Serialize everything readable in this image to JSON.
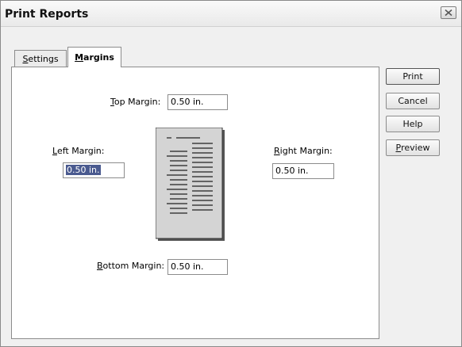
{
  "window": {
    "title": "Print Reports"
  },
  "tabs": [
    {
      "label_ul": "S",
      "label_rest": "ettings"
    },
    {
      "label_ul": "M",
      "label_rest": "argins"
    }
  ],
  "margins": {
    "top": {
      "label_ul": "T",
      "label_rest": "op Margin:",
      "value": "0.50 in."
    },
    "left": {
      "label_ul": "L",
      "label_rest": "eft Margin:",
      "value": "0.50 in."
    },
    "right": {
      "label_ul": "R",
      "label_rest": "ight Margin:",
      "value": "0.50 in."
    },
    "bottom": {
      "label_ul": "B",
      "label_rest": "ottom Margin:",
      "value": "0.50 in."
    }
  },
  "buttons": {
    "print": "Print",
    "cancel": "Cancel",
    "help": "Help",
    "preview_ul": "P",
    "preview_rest": "review"
  },
  "colors": {
    "selection_bg": "#4a5a8f",
    "preview_page_bg": "#d4d4d4"
  },
  "icons": [
    "close-icon",
    "page-preview-icon"
  ]
}
